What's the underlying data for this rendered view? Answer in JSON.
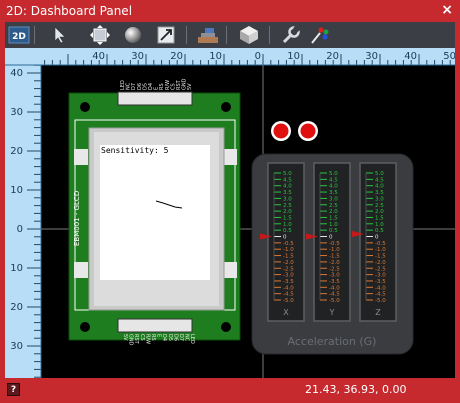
{
  "window": {
    "title": "2D: Dashboard Panel",
    "close_glyph": "×"
  },
  "toolbar": {
    "items": [
      {
        "name": "2d-mode-icon",
        "label": "2D"
      },
      {
        "name": "select-arrow-icon"
      },
      {
        "name": "move-icon"
      },
      {
        "name": "sphere-icon"
      },
      {
        "name": "resize-icon"
      },
      {
        "name": "layers-icon"
      },
      {
        "name": "cube-icon"
      },
      {
        "name": "wrench-icon"
      },
      {
        "name": "color-palette-icon"
      }
    ]
  },
  "ruler": {
    "top_labels": [
      "40",
      "30",
      "20",
      "10",
      "0",
      "10",
      "20",
      "30",
      "40",
      "50"
    ],
    "left_labels": [
      "40",
      "30",
      "20",
      "10",
      "0",
      "10",
      "20",
      "30",
      "40"
    ]
  },
  "glcd": {
    "text": "Sensitivity: 5",
    "side_label": "EBM001 - GLCD",
    "pins_top": [
      "LED",
      "NC",
      "D7",
      "D6",
      "D5",
      "D4",
      "E",
      "RS",
      "R/W",
      "CS",
      "RST",
      "GND",
      "5V"
    ],
    "pins_bottom": [
      "5V",
      "GND",
      "RST",
      "CS",
      "R/W",
      "RS",
      "E",
      "D4",
      "D5",
      "D6",
      "D7",
      "NC",
      "LED"
    ]
  },
  "accelerometer": {
    "title": "Acceleration (G)",
    "scale_labels": [
      "5.0",
      "4.5",
      "4.0",
      "3.5",
      "3.0",
      "2.5",
      "2.0",
      "1.5",
      "1.0",
      "0.5",
      "0",
      "-0.5",
      "-1.0",
      "-1.5",
      "-2.0",
      "-2.5",
      "-3.0",
      "-3.5",
      "-4.0",
      "-4.5",
      "-5.0"
    ],
    "axes": [
      {
        "label": "X",
        "value": 0
      },
      {
        "label": "Y",
        "value": 0
      },
      {
        "label": "Z",
        "value": 0.2
      }
    ],
    "colors": {
      "positive": "#28c83a",
      "negative": "#e07830",
      "pointer": "#c81818"
    }
  },
  "leds": [
    {
      "name": "led-1",
      "color": "#e01010"
    },
    {
      "name": "led-2",
      "color": "#e01010"
    }
  ],
  "status": {
    "help": "?",
    "coordinates": "21.43, 36.93, 0.00"
  }
}
